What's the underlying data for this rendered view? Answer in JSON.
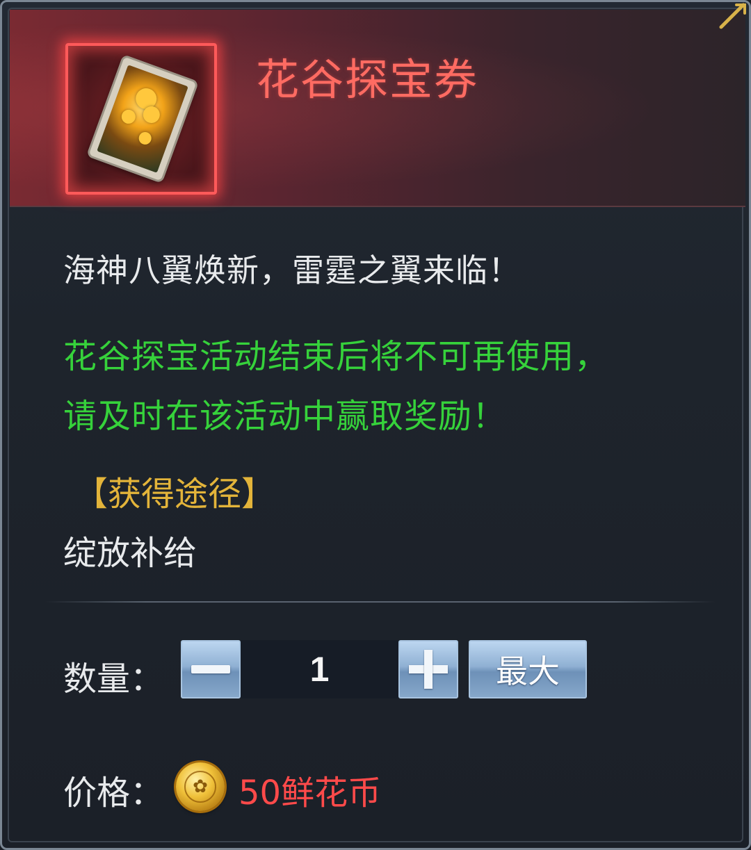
{
  "item": {
    "name": "花谷探宝券",
    "description": "海神八翼焕新，雷霆之翼来临！",
    "notice_line1": "花谷探宝活动结束后将不可再使用，",
    "notice_line2": "请及时在该活动中赢取奖励！"
  },
  "source": {
    "header": "【获得途径】",
    "value": "绽放补给"
  },
  "quantity": {
    "label": "数量：",
    "minus_icon": "minus-icon",
    "plus_icon": "plus-icon",
    "value": "1",
    "max_label": "最大"
  },
  "price": {
    "label": "价格：",
    "coin_icon": "flower-coin-icon",
    "value": "50鲜花币"
  },
  "colors": {
    "title": "#ff6b62",
    "notice": "#36d23b",
    "source_header": "#e3b43a",
    "price": "#ff4a4a"
  }
}
